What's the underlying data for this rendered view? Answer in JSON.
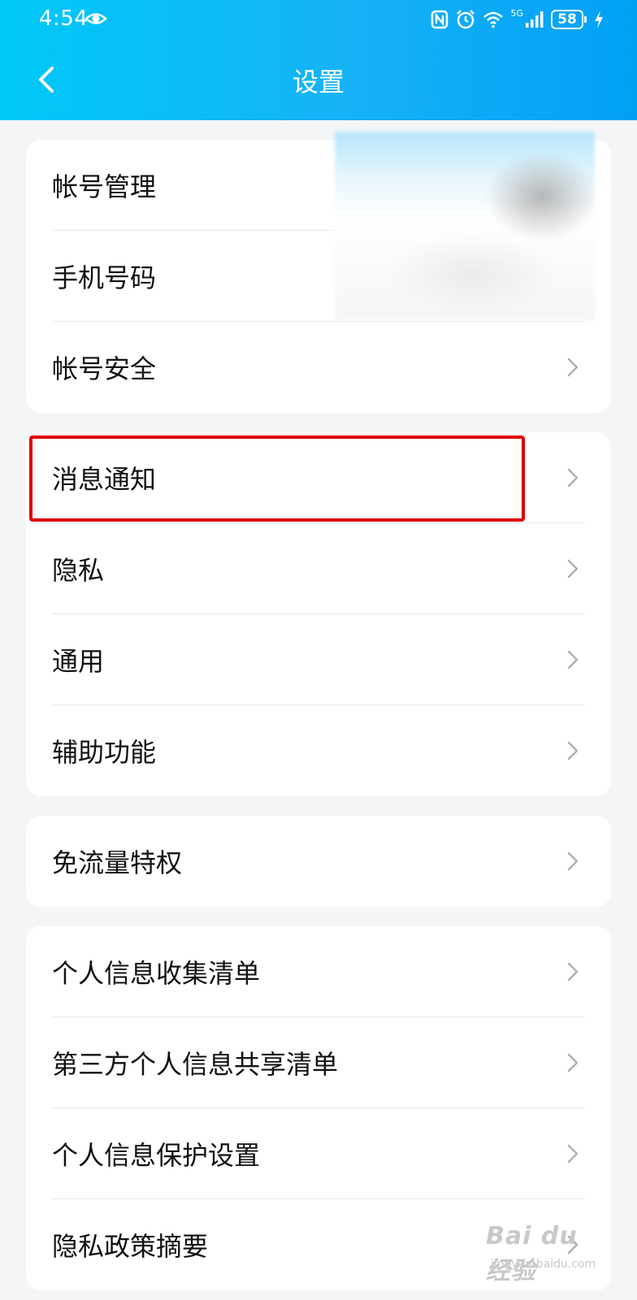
{
  "status_bar": {
    "time": "4:54",
    "battery": "58",
    "network": "5G"
  },
  "header": {
    "title": "设置"
  },
  "groups": [
    {
      "items": [
        "帐号管理",
        "手机号码",
        "帐号安全"
      ]
    },
    {
      "items": [
        "消息通知",
        "隐私",
        "通用",
        "辅助功能"
      ]
    },
    {
      "items": [
        "免流量特权"
      ]
    },
    {
      "items": [
        "个人信息收集清单",
        "第三方个人信息共享清单",
        "个人信息保护设置",
        "隐私政策摘要"
      ]
    }
  ],
  "watermark": {
    "main": "Bai du 经验",
    "sub": "jingyan.baidu.com"
  },
  "colors": {
    "header_gradient_start": "#00c8f8",
    "header_gradient_end": "#00a0f6",
    "background": "#f4f5f7",
    "highlight": "#e00000"
  }
}
